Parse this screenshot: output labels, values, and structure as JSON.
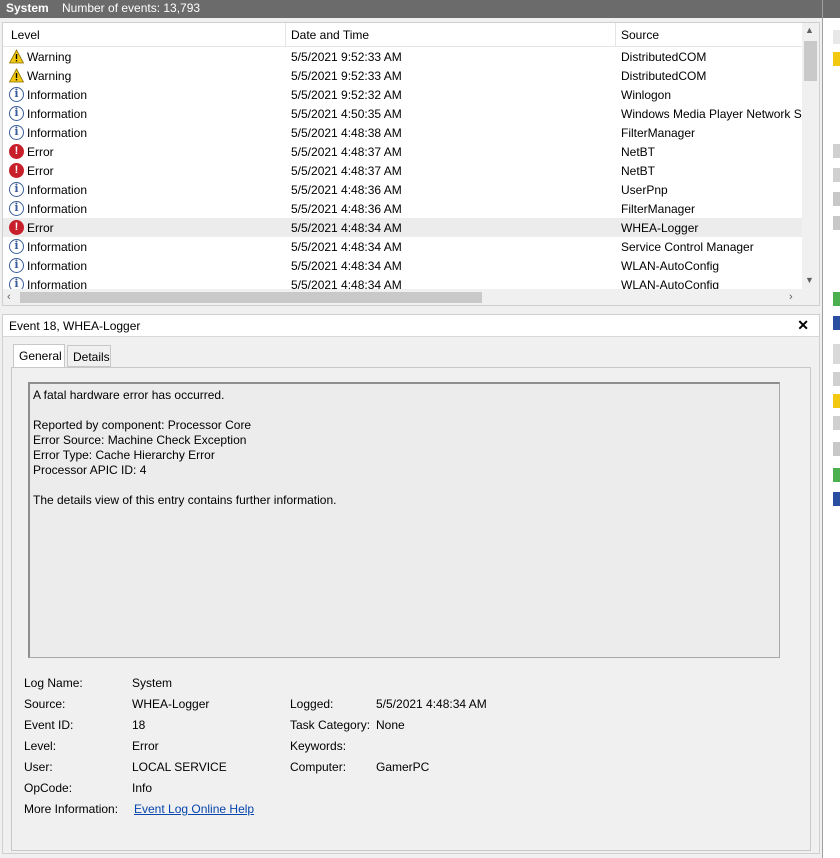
{
  "header": {
    "log_name": "System",
    "event_count": "Number of events: 13,793"
  },
  "columns": {
    "level": "Level",
    "date": "Date and Time",
    "source": "Source"
  },
  "rows": [
    {
      "level": "Warning",
      "type": "warning",
      "date": "5/5/2021 9:52:33 AM",
      "source": "DistributedCOM"
    },
    {
      "level": "Warning",
      "type": "warning",
      "date": "5/5/2021 9:52:33 AM",
      "source": "DistributedCOM"
    },
    {
      "level": "Information",
      "type": "info",
      "date": "5/5/2021 9:52:32 AM",
      "source": "Winlogon"
    },
    {
      "level": "Information",
      "type": "info",
      "date": "5/5/2021 4:50:35 AM",
      "source": "Windows Media Player Network Sh"
    },
    {
      "level": "Information",
      "type": "info",
      "date": "5/5/2021 4:48:38 AM",
      "source": "FilterManager"
    },
    {
      "level": "Error",
      "type": "error",
      "date": "5/5/2021 4:48:37 AM",
      "source": "NetBT"
    },
    {
      "level": "Error",
      "type": "error",
      "date": "5/5/2021 4:48:37 AM",
      "source": "NetBT"
    },
    {
      "level": "Information",
      "type": "info",
      "date": "5/5/2021 4:48:36 AM",
      "source": "UserPnp"
    },
    {
      "level": "Information",
      "type": "info",
      "date": "5/5/2021 4:48:36 AM",
      "source": "FilterManager"
    },
    {
      "level": "Error",
      "type": "error",
      "date": "5/5/2021 4:48:34 AM",
      "source": "WHEA-Logger"
    },
    {
      "level": "Information",
      "type": "info",
      "date": "5/5/2021 4:48:34 AM",
      "source": "Service Control Manager"
    },
    {
      "level": "Information",
      "type": "info",
      "date": "5/5/2021 4:48:34 AM",
      "source": "WLAN-AutoConfig"
    },
    {
      "level": "Information",
      "type": "info",
      "date": "5/5/2021 4:48:34 AM",
      "source": "WLAN-AutoConfig"
    }
  ],
  "detail": {
    "title": "Event 18, WHEA-Logger",
    "close": "✕",
    "tabs": {
      "general": "General",
      "details": "Details"
    },
    "message": {
      "line1": "A fatal hardware error has occurred.",
      "line2": "Reported by component: Processor Core",
      "line3": "Error Source: Machine Check Exception",
      "line4": "Error Type: Cache Hierarchy Error",
      "line5": "Processor APIC ID: 4",
      "line6": "The details view of this entry contains further information."
    },
    "fields": {
      "log_name_label": "Log Name:",
      "log_name": "System",
      "source_label": "Source:",
      "source": "WHEA-Logger",
      "logged_label": "Logged:",
      "logged": "5/5/2021 4:48:34 AM",
      "event_id_label": "Event ID:",
      "event_id": "18",
      "task_category_label": "Task Category:",
      "task_category": "None",
      "level_label": "Level:",
      "level": "Error",
      "keywords_label": "Keywords:",
      "user_label": "User:",
      "user": "LOCAL SERVICE",
      "computer_label": "Computer:",
      "computer": "GamerPC",
      "opcode_label": "OpCode:",
      "opcode": "Info",
      "more_info_label": "More Information:",
      "more_info_link": "Event Log Online Help"
    }
  },
  "colors": {
    "titlebar": "#6b6b6b",
    "error": "#c8202a",
    "info": "#3b5e9a",
    "warning": "#f2c811",
    "link": "#0645ad"
  }
}
